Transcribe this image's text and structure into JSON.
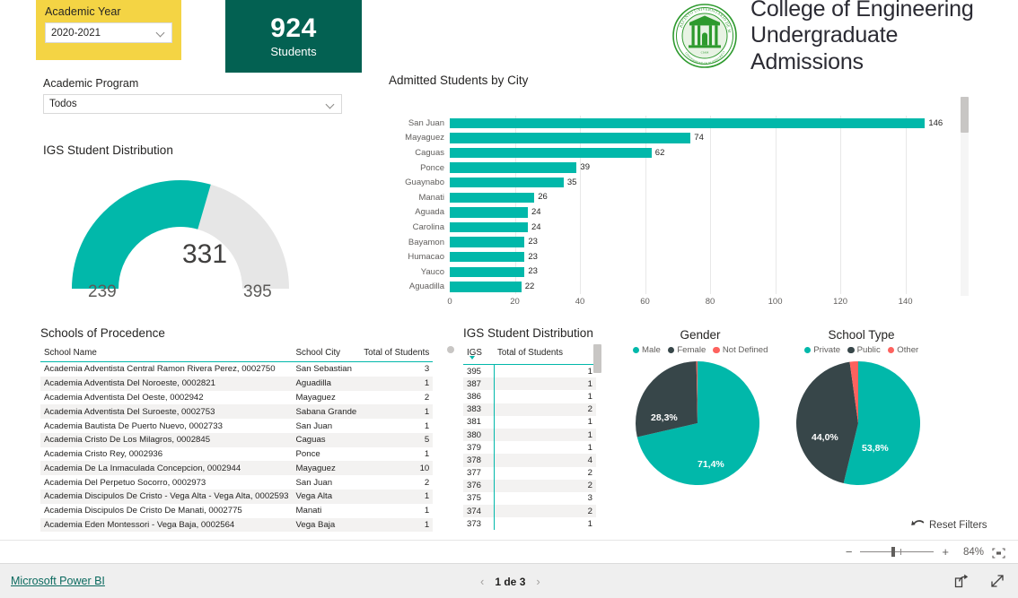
{
  "brand": {
    "line1": "College of Engineering",
    "line2": "Undergraduate Admissions",
    "seal_icon": "upr-mayaguez-seal-icon",
    "seal_color": "#2E9A2E"
  },
  "colors": {
    "teal": "#01B8AA",
    "dark_slice": "#374649",
    "red_slice": "#FD625E",
    "kpi_bg": "#036152",
    "slicer_yellow": "#F4D444",
    "link": "#0B6A5F"
  },
  "slicers": {
    "academic_year": {
      "title": "Academic Year",
      "value": "2020-2021",
      "chevron_icon": "chevron-down-icon"
    },
    "academic_program": {
      "title": "Academic Program",
      "value": "Todos",
      "chevron_icon": "chevron-down-icon"
    }
  },
  "kpi": {
    "value": "924",
    "label": "Students"
  },
  "gauge": {
    "title": "IGS Student Distribution",
    "value": "331",
    "min": "239",
    "max": "395",
    "value_num": 331,
    "min_num": 239,
    "max_num": 395
  },
  "reset": {
    "label": "Reset Filters",
    "icon": "undo-arrow-icon"
  },
  "zoombar": {
    "minus": "−",
    "plus": "+",
    "percent": "84%",
    "fit_icon": "fit-to-page-icon"
  },
  "statusbar": {
    "link": "Microsoft Power BI",
    "page_label": "1 de 3",
    "prev_icon": "chevron-left-icon",
    "next_icon": "chevron-right-icon",
    "share_icon": "share-icon",
    "fullscreen_icon": "fullscreen-expand-icon"
  },
  "chart_data": [
    {
      "type": "bar",
      "orientation": "horizontal",
      "title": "Admitted Students by City",
      "xlabel": "",
      "ylabel": "",
      "categories": [
        "San Juan",
        "Mayaguez",
        "Caguas",
        "Ponce",
        "Guaynabo",
        "Manati",
        "Aguada",
        "Carolina",
        "Bayamon",
        "Humacao",
        "Yauco",
        "Aguadilla"
      ],
      "values": [
        146,
        74,
        62,
        39,
        35,
        26,
        24,
        24,
        23,
        23,
        23,
        22
      ],
      "xlim": [
        0,
        155
      ],
      "xticks": [
        0,
        20,
        40,
        60,
        80,
        100,
        120,
        140
      ],
      "grid": true,
      "data_labels": true,
      "series_color": "#01B8AA",
      "scrollable": true
    },
    {
      "type": "pie",
      "title": "Gender",
      "legend_position": "top",
      "labels": [
        "Male",
        "Female",
        "Not Defined"
      ],
      "values": [
        71.4,
        28.3,
        0.3
      ],
      "display_labels": [
        "71,4%",
        "28,3%",
        ""
      ],
      "colors": [
        "#01B8AA",
        "#374649",
        "#FD625E"
      ]
    },
    {
      "type": "pie",
      "title": "School Type",
      "legend_position": "top",
      "labels": [
        "Private",
        "Public",
        "Other"
      ],
      "values": [
        53.8,
        44.0,
        2.2
      ],
      "display_labels": [
        "53,8%",
        "44,0%",
        ""
      ],
      "colors": [
        "#01B8AA",
        "#374649",
        "#FD625E"
      ]
    },
    {
      "type": "table",
      "title": "Schools of Procedence",
      "columns": [
        "School Name",
        "School City",
        "Total of Students"
      ],
      "rows": [
        [
          "Academia Adventista Central Ramon Rivera Perez, 0002750",
          "San Sebastian",
          "3"
        ],
        [
          "Academia Adventista Del Noroeste, 0002821",
          "Aguadilla",
          "1"
        ],
        [
          "Academia Adventista Del Oeste, 0002942",
          "Mayaguez",
          "2"
        ],
        [
          "Academia Adventista Del Suroeste, 0002753",
          "Sabana Grande",
          "1"
        ],
        [
          "Academia Bautista De Puerto Nuevo, 0002733",
          "San Juan",
          "1"
        ],
        [
          "Academia Cristo De Los Milagros, 0002845",
          "Caguas",
          "5"
        ],
        [
          "Academia Cristo Rey, 0002936",
          "Ponce",
          "1"
        ],
        [
          "Academia De La Inmaculada Concepcion, 0002944",
          "Mayaguez",
          "10"
        ],
        [
          "Academia Del Perpetuo Socorro, 0002973",
          "San Juan",
          "2"
        ],
        [
          "Academia Discipulos De Cristo - Vega Alta - Vega Alta, 0002593",
          "Vega Alta",
          "1"
        ],
        [
          "Academia Discipulos De Cristo De Manati, 0002775",
          "Manati",
          "1"
        ],
        [
          "Academia Eden Montessori - Vega Baja, 0002564",
          "Vega Baja",
          "1"
        ]
      ]
    },
    {
      "type": "table",
      "title": "IGS Student Distribution",
      "columns": [
        "IGS",
        "Total of Students"
      ],
      "sort_column": "IGS",
      "sort_direction": "descending",
      "rows": [
        [
          "395",
          "1"
        ],
        [
          "387",
          "1"
        ],
        [
          "386",
          "1"
        ],
        [
          "383",
          "2"
        ],
        [
          "381",
          "1"
        ],
        [
          "380",
          "1"
        ],
        [
          "379",
          "1"
        ],
        [
          "378",
          "4"
        ],
        [
          "377",
          "2"
        ],
        [
          "376",
          "2"
        ],
        [
          "375",
          "3"
        ],
        [
          "374",
          "2"
        ],
        [
          "373",
          "1"
        ]
      ]
    }
  ]
}
